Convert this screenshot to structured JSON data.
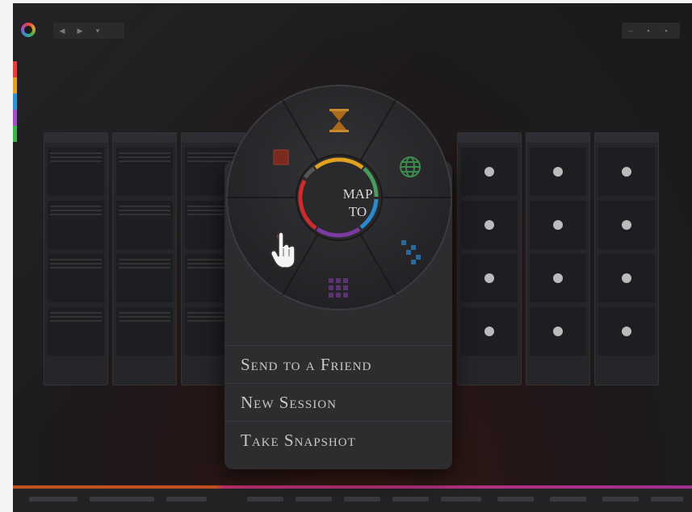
{
  "wheel": {
    "center_line1": "MAP",
    "center_line2": "TO",
    "segments": [
      "hourglass-icon",
      "globe-icon",
      "scatter-icon",
      "grid-icon",
      "pointer-icon",
      "square-icon"
    ]
  },
  "menu": {
    "items": [
      "Send to a Friend",
      "New Session",
      "Take Snapshot"
    ]
  },
  "colors": {
    "ring": [
      "#e0a020",
      "#4a9a5a",
      "#2a8ad0",
      "#7a3aa0",
      "#d02a2a"
    ],
    "accent_bar": "#c05020"
  }
}
